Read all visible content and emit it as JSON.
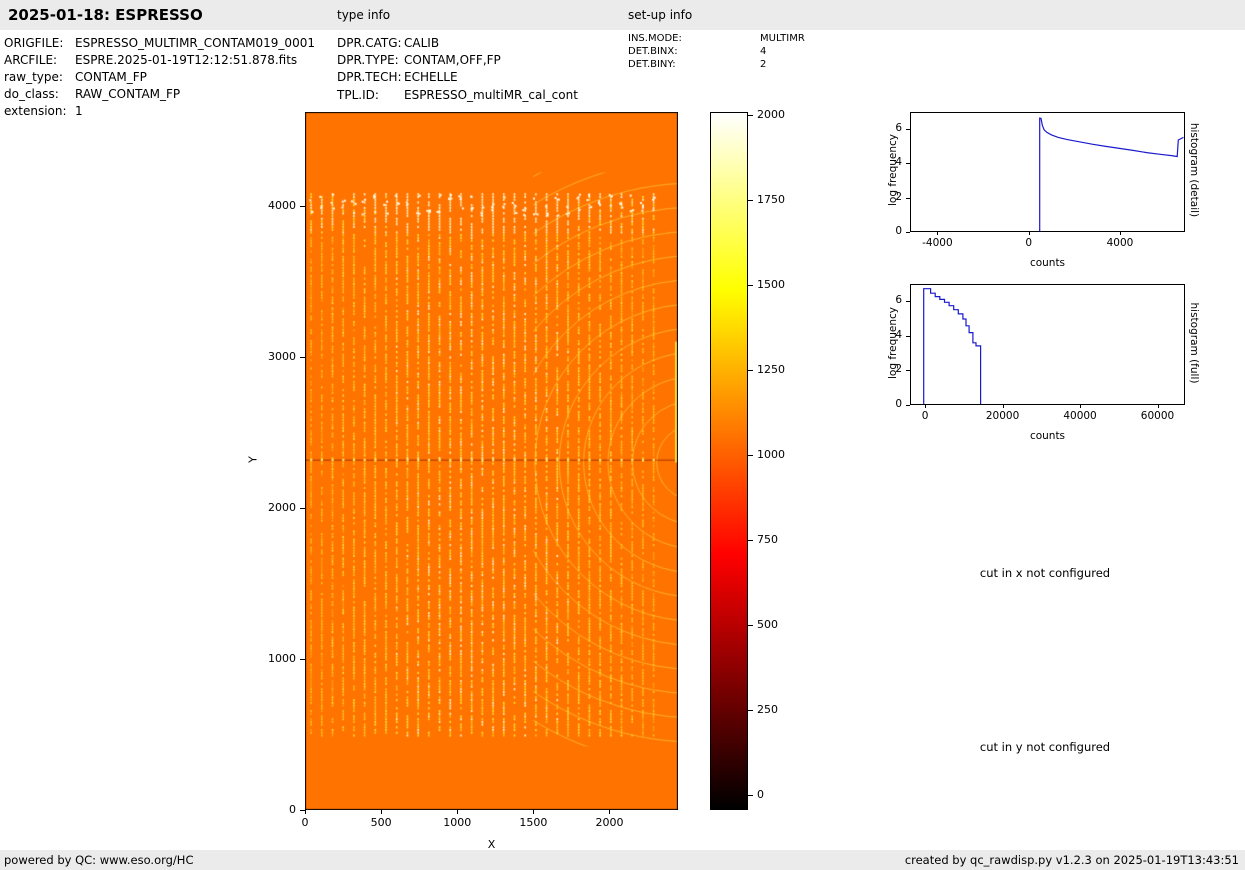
{
  "page": {
    "header": {
      "title": "2025-01-18: ESPRESSO",
      "type_info": "type info",
      "setup_info": "set-up info"
    },
    "file_info": {
      "rows": [
        {
          "label": "ORIGFILE:",
          "value": "ESPRESSO_MULTIMR_CONTAM019_0001"
        },
        {
          "label": "ARCFILE:",
          "value": "ESPRE.2025-01-19T12:12:51.878.fits"
        },
        {
          "label": "raw_type:",
          "value": "CONTAM_FP"
        },
        {
          "label": "do_class:",
          "value": "RAW_CONTAM_FP"
        },
        {
          "label": "extension:",
          "value": "1"
        }
      ]
    },
    "type_info": {
      "rows": [
        {
          "label": "DPR.CATG:",
          "value": "CALIB"
        },
        {
          "label": "DPR.TYPE:",
          "value": "CONTAM,OFF,FP"
        },
        {
          "label": "DPR.TECH:",
          "value": "ECHELLE"
        },
        {
          "label": "TPL.ID:",
          "value": "ESPRESSO_multiMR_cal_cont"
        }
      ]
    },
    "setup_info": {
      "rows": [
        {
          "label": "INS.MODE:",
          "value": "MULTIMR"
        },
        {
          "label": "DET.BINX:",
          "value": "4"
        },
        {
          "label": "DET.BINY:",
          "value": "2"
        }
      ]
    },
    "notes": {
      "cut_x": "cut in x not configured",
      "cut_y": "cut in y not configured"
    },
    "footer": {
      "left": "powered by QC: www.eso.org/HC",
      "right": "created by qc_rawdisp.py v1.2.3 on 2025-01-19T13:43:51"
    }
  },
  "chart_data": [
    {
      "id": "raw_image",
      "type": "heatmap",
      "xlabel": "X",
      "ylabel": "Y",
      "xlim": [
        0,
        2450
      ],
      "ylim": [
        0,
        4620
      ],
      "xticks": [
        0,
        500,
        1000,
        1500,
        2000
      ],
      "yticks": [
        0,
        1000,
        2000,
        3000,
        4000
      ],
      "colormap": "hot",
      "background_counts": 1000,
      "background_color": "#ff7300",
      "stripe_colors": [
        "#ffa010",
        "#ffc31c",
        "#ffe136",
        "#fff6c0"
      ],
      "feature_line_color": "#c24400",
      "stripes": {
        "count": 33,
        "x_start": 40,
        "x_end": 2290,
        "y_bottom": 500,
        "y_top": 4100
      },
      "feature_line_y": 2320,
      "arc_center": [
        2560,
        2300
      ],
      "arc_radii_range": [
        250,
        2300
      ],
      "description": "ESPRESSO raw CONTAM_FP detector frame: ~33 dashed vertical echelle-order stripes (y=500..4100, brighter near top) on an ~1000-count orange background, nested interference arcs on the right side, and a horizontal feature line at y=2320"
    },
    {
      "id": "colorbar",
      "type": "colorbar",
      "vmin": 0,
      "vmax": 2000,
      "ticks": [
        0,
        250,
        500,
        750,
        1000,
        1250,
        1500,
        1750,
        2000
      ],
      "colormap": "hot",
      "colormap_stops": [
        [
          0,
          "#000000"
        ],
        [
          0.365,
          "#ff0000"
        ],
        [
          0.746,
          "#ffff00"
        ],
        [
          1,
          "#ffffff"
        ]
      ]
    },
    {
      "id": "hist_detail",
      "type": "line",
      "right_label": "histogram (detail)",
      "xlabel": "counts",
      "ylabel": "log frequency",
      "xlim": [
        -5200,
        6850
      ],
      "ylim": [
        0,
        7
      ],
      "xticks": [
        -4000,
        0,
        4000
      ],
      "yticks": [
        0,
        2,
        4,
        6
      ],
      "line_color": "#1a1acd",
      "points": [
        [
          480,
          0
        ],
        [
          480,
          6.7
        ],
        [
          540,
          6.68
        ],
        [
          600,
          6.25
        ],
        [
          680,
          6.0
        ],
        [
          800,
          5.85
        ],
        [
          1000,
          5.7
        ],
        [
          1300,
          5.55
        ],
        [
          1700,
          5.42
        ],
        [
          2200,
          5.3
        ],
        [
          2800,
          5.15
        ],
        [
          3400,
          5.02
        ],
        [
          4000,
          4.9
        ],
        [
          4600,
          4.78
        ],
        [
          5200,
          4.65
        ],
        [
          5800,
          4.55
        ],
        [
          6300,
          4.47
        ],
        [
          6550,
          4.42
        ],
        [
          6600,
          5.4
        ],
        [
          6830,
          5.55
        ]
      ]
    },
    {
      "id": "hist_full",
      "type": "line",
      "right_label": "histogram (full)",
      "xlabel": "counts",
      "ylabel": "log frequency",
      "xlim": [
        -3900,
        67100
      ],
      "ylim": [
        0,
        7
      ],
      "xticks": [
        0,
        20000,
        40000,
        60000
      ],
      "yticks": [
        0,
        2,
        4,
        6
      ],
      "line_color": "#1a1acd",
      "points": [
        [
          -600,
          0
        ],
        [
          -600,
          6.78
        ],
        [
          1200,
          6.78
        ],
        [
          1200,
          6.52
        ],
        [
          2400,
          6.52
        ],
        [
          2400,
          6.32
        ],
        [
          3600,
          6.32
        ],
        [
          3600,
          6.15
        ],
        [
          4800,
          6.15
        ],
        [
          4800,
          5.98
        ],
        [
          6000,
          5.98
        ],
        [
          6000,
          5.78
        ],
        [
          7200,
          5.78
        ],
        [
          7200,
          5.55
        ],
        [
          8400,
          5.55
        ],
        [
          8400,
          5.3
        ],
        [
          9600,
          5.3
        ],
        [
          9600,
          5.0
        ],
        [
          10400,
          5.0
        ],
        [
          10400,
          4.6
        ],
        [
          11200,
          4.6
        ],
        [
          11200,
          4.2
        ],
        [
          12200,
          4.2
        ],
        [
          12200,
          3.6
        ],
        [
          13000,
          3.6
        ],
        [
          13000,
          3.42
        ],
        [
          14200,
          3.42
        ],
        [
          14200,
          0
        ]
      ]
    }
  ]
}
